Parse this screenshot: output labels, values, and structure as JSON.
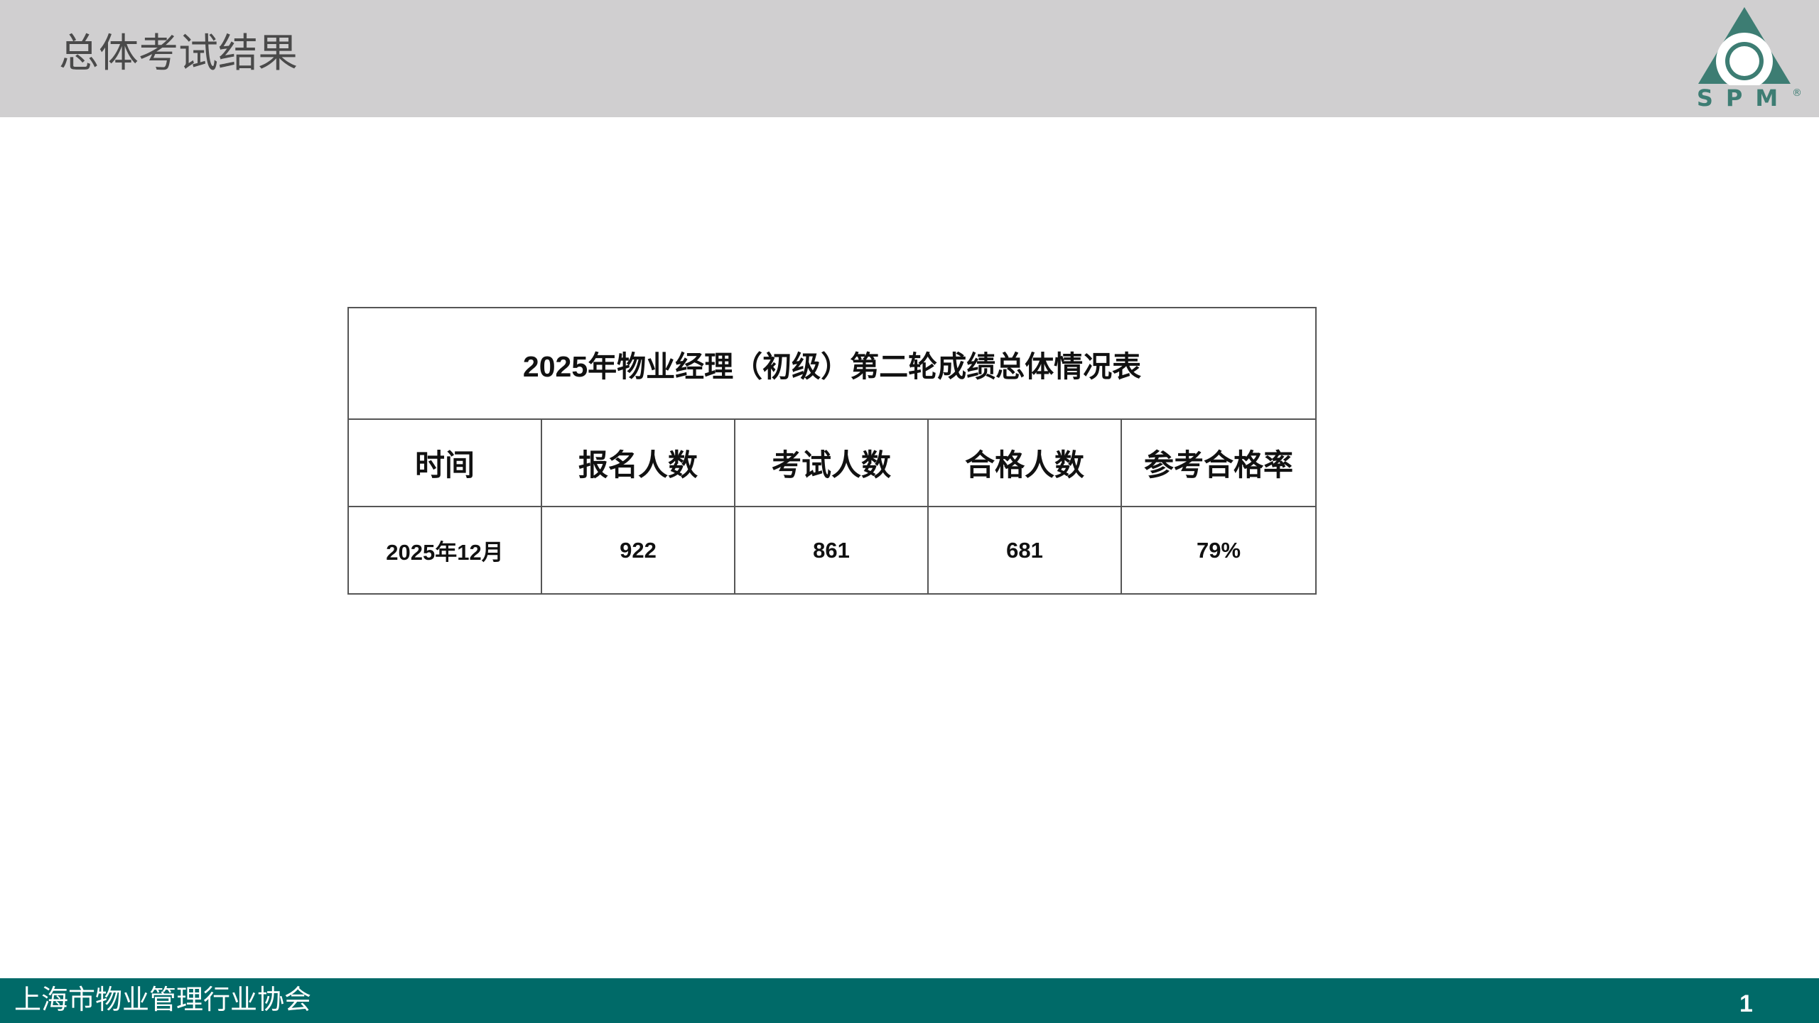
{
  "header": {
    "title": "总体考试结果",
    "logo_text": "SPM",
    "logo_mark": "®"
  },
  "table": {
    "caption": "2025年物业经理（初级）第二轮成绩总体情况表",
    "columns": [
      "时间",
      "报名人数",
      "考试人数",
      "合格人数",
      "参考合格率"
    ],
    "rows": [
      [
        "2025年12月",
        "922",
        "861",
        "681",
        "79%"
      ]
    ]
  },
  "footer": {
    "organization": "上海市物业管理行业协会",
    "page_number": "1"
  },
  "colors": {
    "header_band": "#d0cfd0",
    "footer_band": "#006a68",
    "logo_green": "#3d7d73"
  }
}
